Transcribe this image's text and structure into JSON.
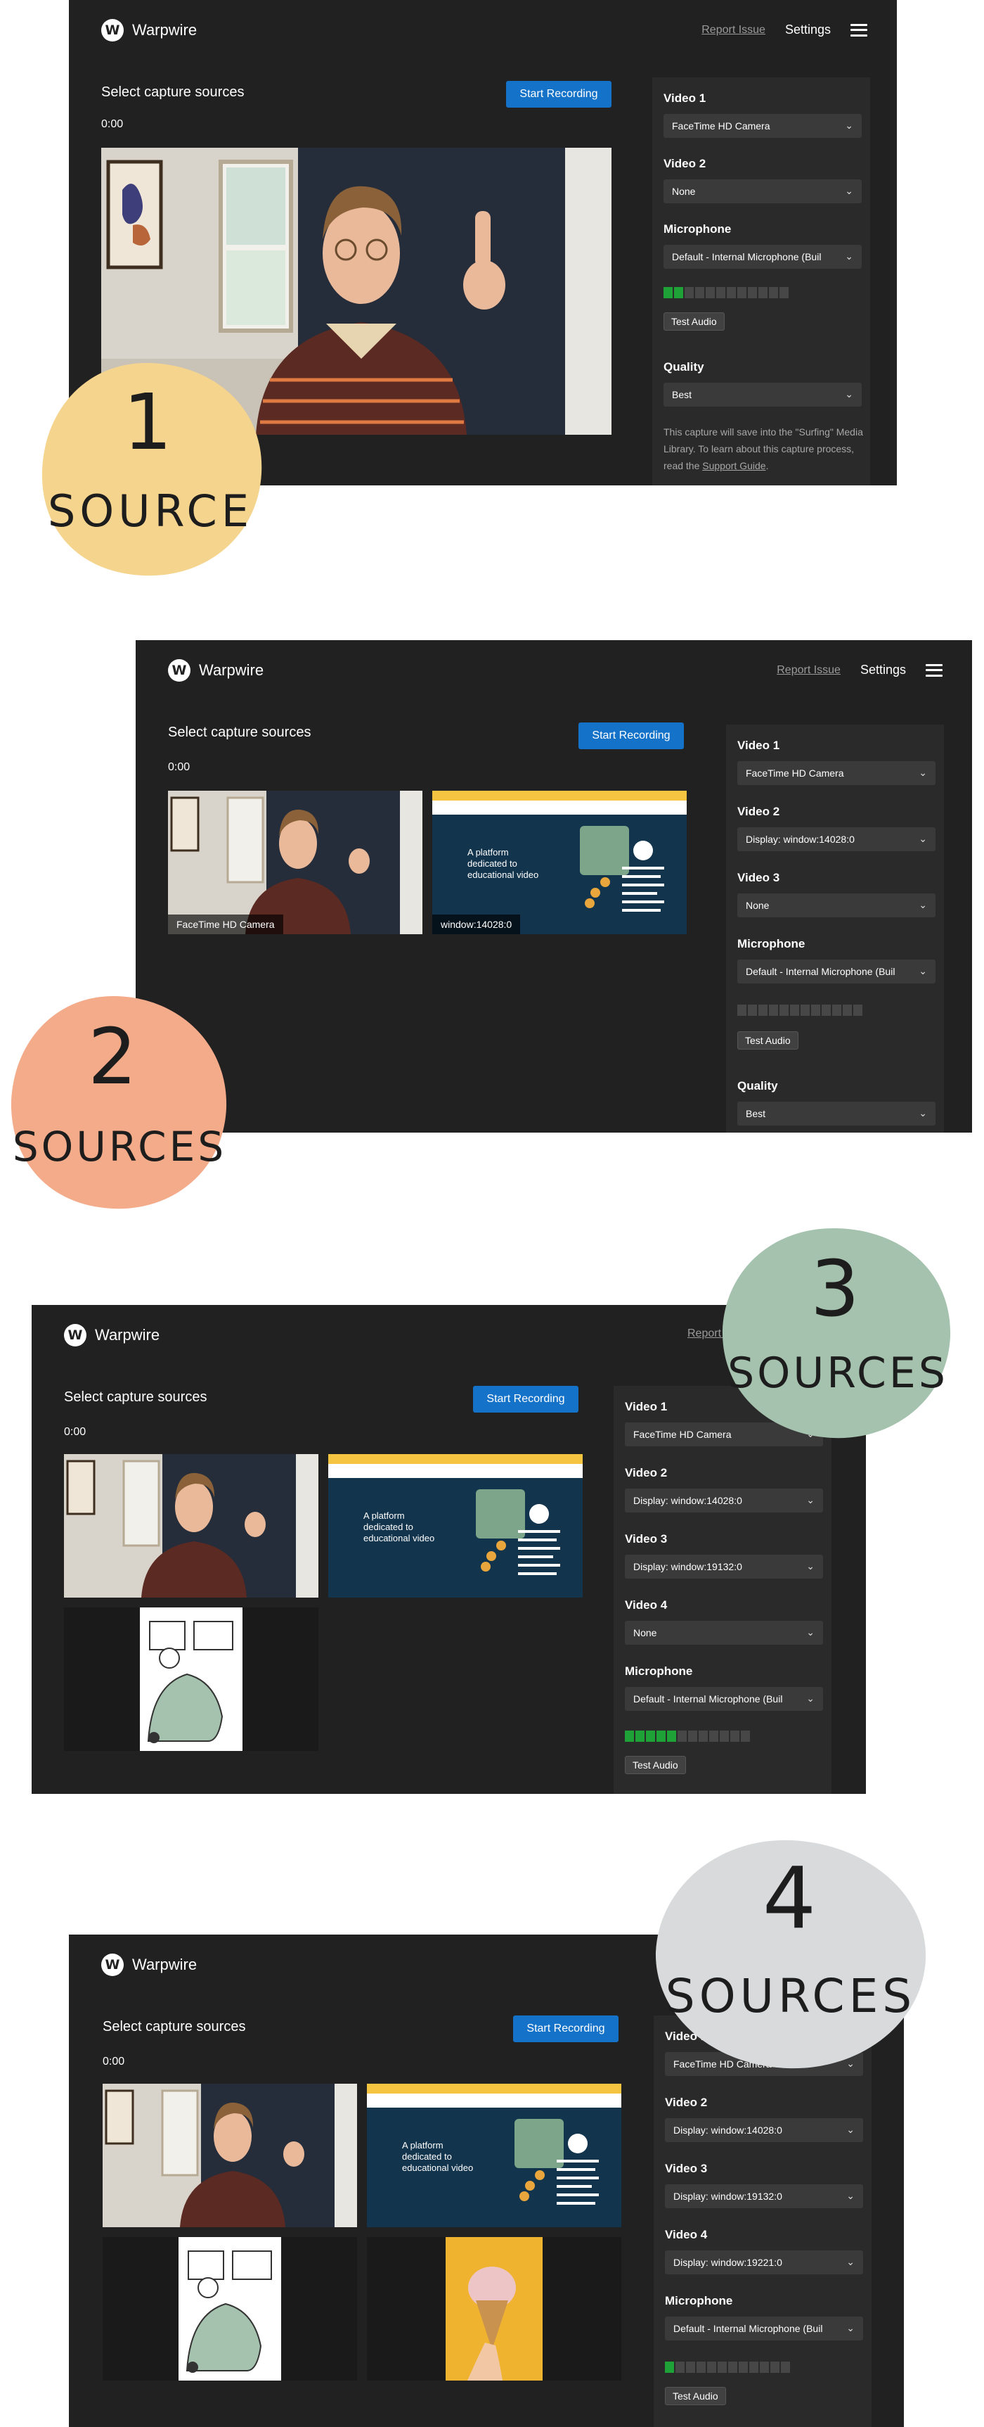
{
  "app": {
    "logo_letter": "W",
    "logo_name": "Warpwire",
    "report_issue": "Report Issue",
    "settings": "Settings",
    "capture_title": "Select capture sources",
    "timer": "0:00",
    "start_recording": "Start Recording"
  },
  "labels": {
    "video1": "Video 1",
    "video2": "Video 2",
    "video3": "Video 3",
    "video4": "Video 4",
    "microphone": "Microphone",
    "quality": "Quality",
    "test_audio": "Test Audio"
  },
  "values": {
    "camera": "FaceTime HD Camera",
    "none": "None",
    "display1": "Display: window:14028:0",
    "display2": "Display: window:19132:0",
    "display3": "Display: window:19221:0",
    "mic": "Default - Internal Microphone (Built-in)",
    "best": "Best"
  },
  "tile_labels": {
    "camera": "FaceTime HD Camera",
    "window": "window:14028:0"
  },
  "note": {
    "text": "This capture will save into the \"Surfing\" Media Library. To learn about this capture process, read the",
    "link": "Support Guide",
    "end": "."
  },
  "screen_text": {
    "headline": "A platform dedicated to educational video"
  },
  "meters": {
    "s1": 0.17,
    "s2": 0.0,
    "s3": 0.42,
    "s4": 0.08
  },
  "badges": [
    {
      "number": "1",
      "word": "SOURCE",
      "color": "#f5d48e"
    },
    {
      "number": "2",
      "word": "SOURCES",
      "color": "#f3ab8a"
    },
    {
      "number": "3",
      "word": "SOURCES",
      "color": "#a4c2ad"
    },
    {
      "number": "4",
      "word": "SOURCES",
      "color": "#d8dadb"
    }
  ],
  "colors": {
    "app_bg": "#212121",
    "panel_bg": "#2a2a2a",
    "select_bg": "#3a3a3a",
    "accent_blue": "#1473c9",
    "meter_on": "#1ea136",
    "screen_navy": "#12344d"
  }
}
